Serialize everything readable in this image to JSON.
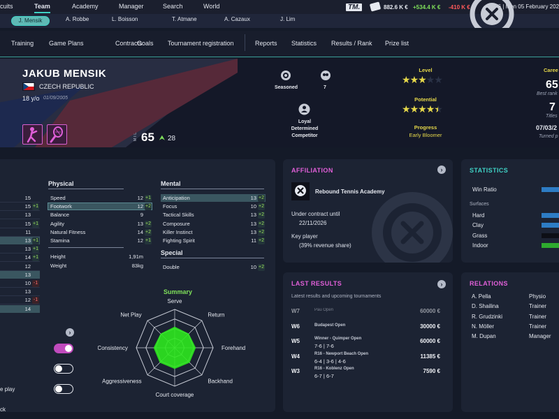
{
  "topnav": {
    "items": [
      "cuits",
      "Team",
      "Academy",
      "Manager",
      "Search",
      "World"
    ],
    "logo": "TM.",
    "money": "882.6 K €",
    "income": "+534.4 K €",
    "expense": "-410 K €",
    "date": "W6 | Mon 05 February 2024"
  },
  "player_tabs": [
    "J. Mensik",
    "A. Robbe",
    "L. Boisson",
    "T. Atmane",
    "A. Cazaux",
    "J. Lim"
  ],
  "subnav": {
    "left": [
      "Training",
      "Game Plans",
      "Contracts",
      "Goals",
      "Tournament registration"
    ],
    "right": [
      "Reports",
      "Statistics",
      "Results / Rank",
      "Prize list"
    ]
  },
  "player": {
    "name": "JAKUB MENSIK",
    "country": "CZECH REPUBLIC",
    "age": "18 y/o",
    "dob": "01/09/2005",
    "mtl_label": "MTL",
    "mtl": "65",
    "mtl_growth": "28",
    "level_stars": 3,
    "potential_stars": 4.5,
    "status_label": "Seasoned",
    "titles_icon_value": "7",
    "traits": [
      "Loyal",
      "Determined",
      "Competitor"
    ],
    "level_label": "Level",
    "potential_label": "Potential",
    "progress_label": "Progress",
    "progress_value": "Early Bloomer",
    "career_label": "Caree",
    "career_rank": "65",
    "career_rank_label": "Best rank",
    "career_titles": "7",
    "career_titles_label": "Titles",
    "career_date": "07/03/2",
    "career_date_label": "Turned p"
  },
  "left_panel": {
    "partial_values": [
      {
        "v": "15",
        "d": "",
        "hl": false
      },
      {
        "v": "15",
        "d": "+1",
        "hl": false
      },
      {
        "v": "13",
        "d": "",
        "hl": false
      },
      {
        "v": "15",
        "d": "+1",
        "hl": false
      },
      {
        "v": "11",
        "d": "",
        "hl": false
      },
      {
        "v": "13",
        "d": "+1",
        "hl": true
      },
      {
        "v": "13",
        "d": "+1",
        "hl": false
      },
      {
        "v": "14",
        "d": "+1",
        "hl": false
      },
      {
        "v": "12",
        "d": "",
        "hl": false
      },
      {
        "v": "13",
        "d": "",
        "hl": true
      },
      {
        "v": "10",
        "d": "-1",
        "hl": false
      },
      {
        "v": "13",
        "d": "",
        "hl": false
      },
      {
        "v": "12",
        "d": "-1",
        "hl": false
      },
      {
        "v": "14",
        "d": "",
        "hl": true
      }
    ],
    "toggles": [
      {
        "label": "",
        "on": true
      },
      {
        "label": "e play",
        "on": false
      },
      {
        "label": "ck",
        "on": false
      }
    ]
  },
  "physical": {
    "title": "Physical",
    "rows": [
      {
        "name": "Speed",
        "v": "12",
        "d": "+1"
      },
      {
        "name": "Footwork",
        "v": "12",
        "d": "+2"
      },
      {
        "name": "Balance",
        "v": "9",
        "d": ""
      },
      {
        "name": "Agility",
        "v": "13",
        "d": "+2"
      },
      {
        "name": "Natural Fitness",
        "v": "14",
        "d": "+2"
      },
      {
        "name": "Stamina",
        "v": "12",
        "d": "+1"
      }
    ],
    "extra": [
      {
        "name": "Height",
        "v": "1,91m"
      },
      {
        "name": "Weight",
        "v": "83kg"
      }
    ]
  },
  "mental": {
    "title": "Mental",
    "rows": [
      {
        "name": "Anticipation",
        "v": "13",
        "d": "+2"
      },
      {
        "name": "Focus",
        "v": "10",
        "d": "+2"
      },
      {
        "name": "Tactical Skills",
        "v": "13",
        "d": "+2"
      },
      {
        "name": "Composure",
        "v": "13",
        "d": "+2"
      },
      {
        "name": "Killer Instinct",
        "v": "13",
        "d": "+2"
      },
      {
        "name": "Fighting Spirit",
        "v": "11",
        "d": "+2"
      }
    ]
  },
  "special": {
    "title": "Special",
    "rows": [
      {
        "name": "Double",
        "v": "10",
        "d": "+2"
      }
    ]
  },
  "summary": {
    "title": "Summary",
    "axes": [
      "Serve",
      "Return",
      "Forehand",
      "Backhand",
      "Court coverage",
      "Aggressiveness",
      "Consistency",
      "Net Play"
    ],
    "values": [
      0.55,
      0.52,
      0.55,
      0.55,
      0.55,
      0.55,
      0.55,
      0.52
    ]
  },
  "affiliation": {
    "title": "AFFILIATION",
    "academy": "Rebound Tennis Academy",
    "contract_label": "Under contract until",
    "contract_date": "22/11/2026",
    "key_label": "Key player",
    "share": "(39% revenue share)"
  },
  "statistics": {
    "title": "STATISTICS",
    "win_ratio": "Win Ratio",
    "surfaces_label": "Surfaces",
    "surfaces": [
      "Hard",
      "Clay",
      "Grass",
      "Indoor"
    ]
  },
  "last_results": {
    "title": "LAST RESULTS",
    "subtitle": "Latest results and upcoming tournaments",
    "rows": [
      {
        "week": "W7",
        "tour": "Pau Open",
        "score": "",
        "prize": "60000 €",
        "dim": true
      },
      {
        "week": "W6",
        "tour": "Budapest Open",
        "score": "",
        "prize": "30000 €",
        "dim": false
      },
      {
        "week": "W5",
        "tour": "Winner - Quimper Open",
        "score": "7-6 | 7-6",
        "prize": "60000 €",
        "dim": false
      },
      {
        "week": "W4",
        "tour": "R16 - Newport Beach Open",
        "score": "6-4 | 3-6 | 4-6",
        "prize": "11385 €",
        "dim": false
      },
      {
        "week": "W3",
        "tour": "R16 - Koblenz Open",
        "score": "6-7 | 6-7",
        "prize": "7590 €",
        "dim": false
      }
    ]
  },
  "relations": {
    "title": "RELATIONS",
    "rows": [
      {
        "name": "A. Pella",
        "role": "Physio"
      },
      {
        "name": "D. Shailina",
        "role": "Trainer"
      },
      {
        "name": "R. Grudzinki",
        "role": "Trainer"
      },
      {
        "name": "N. Möller",
        "role": "Trainer"
      },
      {
        "name": "M. Dupan",
        "role": "Manager"
      }
    ]
  },
  "colors": {
    "accent": "#3fd1c5",
    "pink": "#e05fd8",
    "green": "#9be35a",
    "radar": "#2ee81e"
  }
}
